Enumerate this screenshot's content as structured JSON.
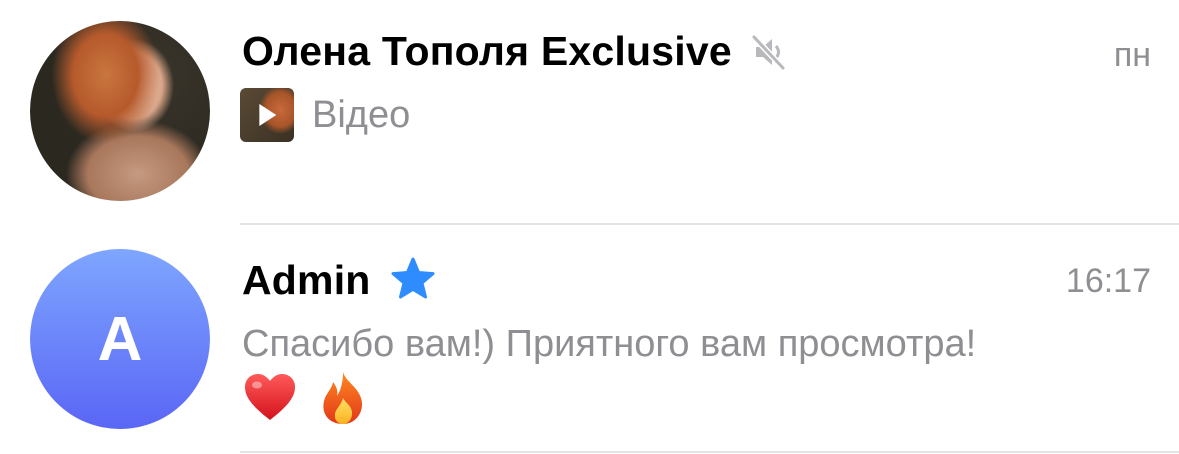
{
  "chats": [
    {
      "title": "Олена Тополя Exclusive",
      "muted": true,
      "time": "пн",
      "preview_label": "Відео",
      "avatar": "photo-avatar",
      "preview_icon": "video-thumbnail-icon"
    },
    {
      "title": "Admin",
      "verified": true,
      "time": "16:17",
      "avatar_letter": "A",
      "message": "Спасибо вам!) Приятного вам просмотра!",
      "emojis": [
        "heart-emoji",
        "fire-emoji"
      ]
    }
  ],
  "colors": {
    "secondary_text": "#8e8e93",
    "verified_star": "#2f8cff",
    "avatar_gradient_top": "#7ea6ff",
    "avatar_gradient_bottom": "#5a66f5",
    "divider": "#e3e3e6"
  }
}
